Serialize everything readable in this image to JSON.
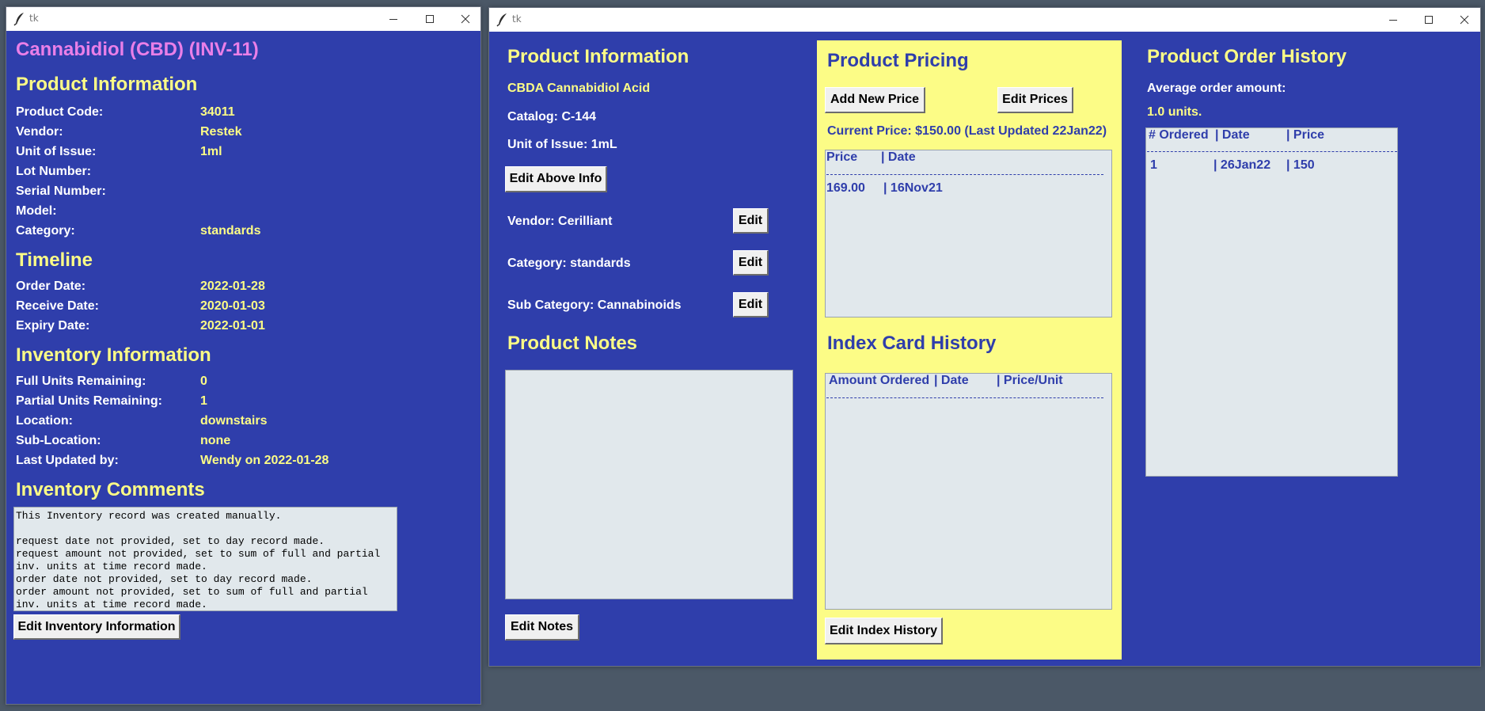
{
  "left_window": {
    "title": "tk",
    "product_title": "Cannabidiol (CBD) (INV-11)",
    "product_info": {
      "heading": "Product Information",
      "fields": [
        {
          "label": "Product Code:",
          "value": "34011"
        },
        {
          "label": "Vendor:",
          "value": "Restek"
        },
        {
          "label": "Unit of Issue:",
          "value": "1ml"
        },
        {
          "label": "Lot Number:",
          "value": ""
        },
        {
          "label": "Serial Number:",
          "value": ""
        },
        {
          "label": "Model:",
          "value": ""
        },
        {
          "label": "Category:",
          "value": "standards"
        }
      ]
    },
    "timeline": {
      "heading": "Timeline",
      "fields": [
        {
          "label": "Order Date:",
          "value": "2022-01-28"
        },
        {
          "label": "Receive Date:",
          "value": "2020-01-03"
        },
        {
          "label": "Expiry Date:",
          "value": "2022-01-01"
        }
      ]
    },
    "inventory": {
      "heading": "Inventory Information",
      "fields": [
        {
          "label": "Full Units Remaining:",
          "value": "0"
        },
        {
          "label": "Partial Units Remaining:",
          "value": "1"
        },
        {
          "label": "Location:",
          "value": "downstairs"
        },
        {
          "label": "Sub-Location:",
          "value": "none"
        },
        {
          "label": "Last Updated by:",
          "value": "Wendy on 2022-01-28"
        }
      ]
    },
    "comments": {
      "heading": "Inventory Comments",
      "text": "This Inventory record was created manually.\n\nrequest date not provided, set to day record made.\nrequest amount not provided, set to sum of full and partial\ninv. units at time record made.\norder date not provided, set to day record made.\norder amount not provided, set to sum of full and partial\ninv. units at time record made."
    },
    "edit_button": "Edit Inventory Information"
  },
  "right_window": {
    "title": "tk",
    "product_info": {
      "heading": "Product Information",
      "name": "CBDA Cannabidiol Acid",
      "catalog": "Catalog: C-144",
      "unit": "Unit of Issue: 1mL",
      "edit_above_button": "Edit Above Info",
      "vendor": "Vendor: Cerilliant",
      "category": "Category: standards",
      "sub_category": "Sub Category: Cannabinoids",
      "edit_label": "Edit"
    },
    "notes": {
      "heading": "Product Notes",
      "text": "",
      "edit_button": "Edit Notes"
    },
    "pricing": {
      "heading": "Product Pricing",
      "add_button": "Add New Price",
      "edit_button": "Edit Prices",
      "current_price": "Current Price: $150.00 (Last Updated 22Jan22)",
      "columns": [
        "Price",
        "| Date"
      ],
      "rows": [
        [
          "169.00",
          "| 16Nov21"
        ]
      ]
    },
    "index_card": {
      "heading": "Index Card History",
      "columns": [
        "Amount Ordered",
        "| Date",
        "| Price/Unit"
      ],
      "rows": [],
      "edit_button": "Edit Index History"
    },
    "order_history": {
      "heading": "Product Order History",
      "avg_label": "Average order amount:",
      "avg_value": "1.0 units.",
      "columns": [
        "# Ordered",
        "| Date",
        "| Price"
      ],
      "rows": [
        [
          "1",
          "| 26Jan22",
          "| 150"
        ]
      ]
    }
  },
  "colors": {
    "window_bg": "#2f3eab",
    "heading_yellow": "#fcfc86",
    "title_pink": "#ea7fe8",
    "panel_yellow": "#fcfc86",
    "list_bg": "#e1e8ec",
    "desktop": "#4b5867"
  }
}
